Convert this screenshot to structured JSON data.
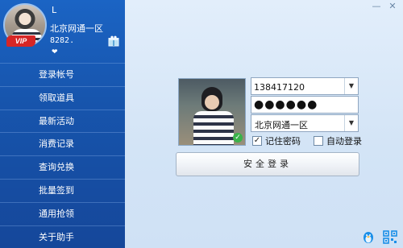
{
  "profile": {
    "username": "L",
    "region": "北京网通一区",
    "points": "8282.",
    "vip_label": "VIP"
  },
  "menu": [
    {
      "label": "登录帐号"
    },
    {
      "label": "领取道具"
    },
    {
      "label": "最新活动"
    },
    {
      "label": "消费记录"
    },
    {
      "label": "查询兑换"
    },
    {
      "label": "批量签到"
    },
    {
      "label": "通用抢领"
    },
    {
      "label": "关于助手"
    }
  ],
  "login": {
    "account": "138417120",
    "password_mask": "●●●●●●",
    "region": "北京网通一区",
    "remember_label": "记住密码",
    "remember_checked": true,
    "auto_label": "自动登录",
    "auto_checked": false,
    "button_label": "安全登录"
  },
  "colors": {
    "sidebar": "#1755ad",
    "vip": "#d62626",
    "check": "#3bb24a"
  }
}
